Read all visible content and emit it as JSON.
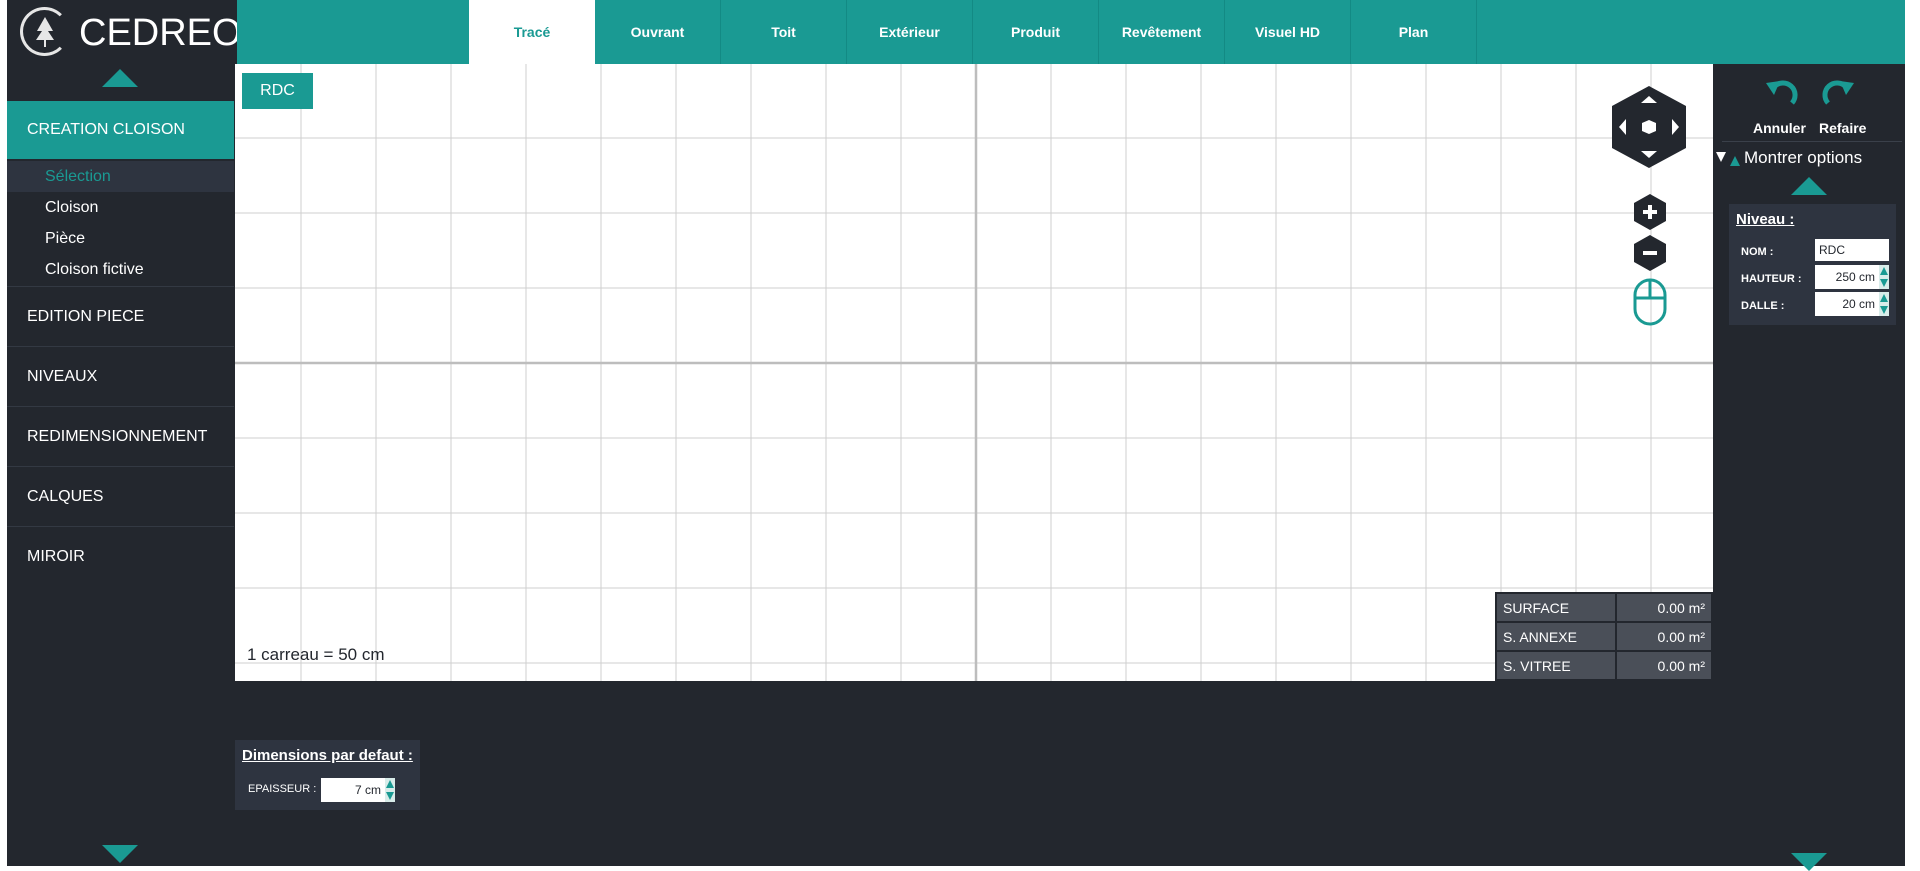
{
  "app": {
    "logo_text": "CEDREO"
  },
  "tabs": [
    {
      "label": "Tracé",
      "active": true
    },
    {
      "label": "Ouvrant",
      "active": false
    },
    {
      "label": "Toit",
      "active": false
    },
    {
      "label": "Extérieur",
      "active": false
    },
    {
      "label": "Produit",
      "active": false
    },
    {
      "label": "Revêtement",
      "active": false
    },
    {
      "label": "Visuel HD",
      "active": false
    },
    {
      "label": "Plan",
      "active": false
    }
  ],
  "sidebar": {
    "active_section": "CREATION CLOISON",
    "sub_items": [
      {
        "label": "Sélection",
        "selected": true
      },
      {
        "label": "Cloison",
        "selected": false
      },
      {
        "label": "Pièce",
        "selected": false
      },
      {
        "label": "Cloison fictive",
        "selected": false
      }
    ],
    "sections": [
      "EDITION PIECE",
      "NIVEAUX",
      "REDIMENSIONNEMENT",
      "CALQUES",
      "MIROIR"
    ]
  },
  "canvas": {
    "level_badge": "RDC",
    "scale_label": "1 carreau = 50 cm",
    "surfaces": [
      {
        "label": "SURFACE",
        "value": "0.00 m²"
      },
      {
        "label": "S. ANNEXE",
        "value": "0.00 m²"
      },
      {
        "label": "S. VITREE",
        "value": "0.00 m²"
      }
    ]
  },
  "defaults": {
    "title": "Dimensions par defaut :",
    "epaisseur_label": "EPAISSEUR :",
    "epaisseur_value": "7 cm"
  },
  "right_panel": {
    "undo_label": "Annuler",
    "redo_label": "Refaire",
    "show_options": "Montrer options",
    "niveau": {
      "title": "Niveau :",
      "nom_label": "NOM :",
      "nom_value": "RDC",
      "hauteur_label": "HAUTEUR :",
      "hauteur_value": "250 cm",
      "dalle_label": "DALLE :",
      "dalle_value": "20 cm"
    }
  },
  "colors": {
    "accent": "#1a9a93",
    "dark": "#23272e",
    "panel": "#2e3440"
  }
}
